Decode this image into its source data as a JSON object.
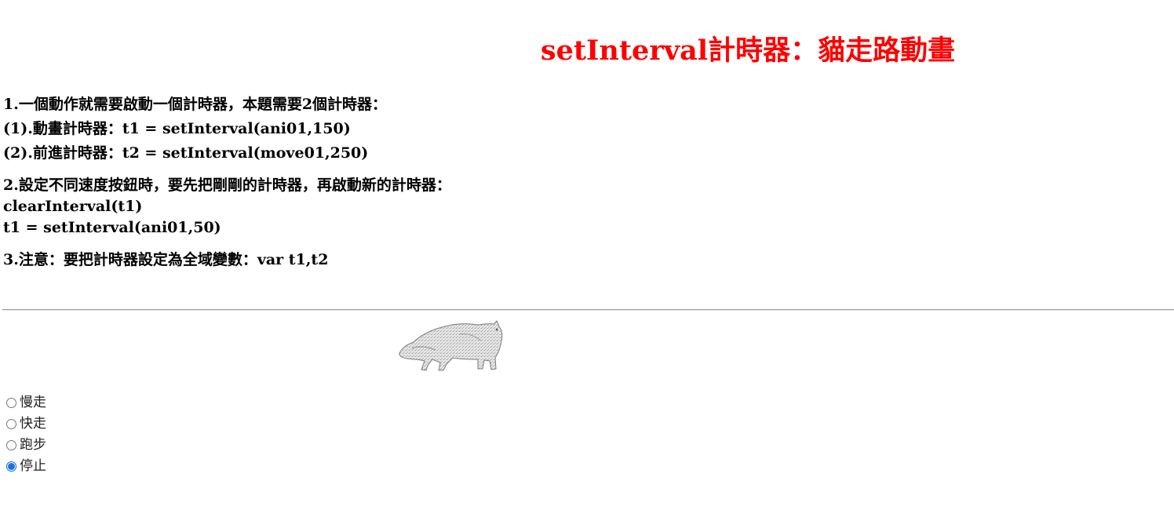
{
  "title": "setInterval計時器：貓走路動畫",
  "notes": {
    "n1": {
      "heading": "1.一個動作就需要啟動一個計時器，本題需要2個計時器：",
      "line1": "(1).動畫計時器：t1 = setInterval(ani01,150)",
      "line2": "(2).前進計時器：t2 = setInterval(move01,250)"
    },
    "n2": {
      "heading": "2.設定不同速度按鈕時，要先把剛剛的計時器，再啟動新的計時器：",
      "line1": "clearInterval(t1)",
      "line2": "t1 = setInterval(ani01,50)"
    },
    "n3": {
      "heading": "3.注意：要把計時器設定為全域變數：var t1,t2"
    }
  },
  "speed_options": [
    {
      "label": "慢走",
      "checked": false
    },
    {
      "label": "快走",
      "checked": false
    },
    {
      "label": "跑步",
      "checked": false
    },
    {
      "label": "停止",
      "checked": true
    }
  ],
  "colors": {
    "title": "#ff0000",
    "radio_checked": "#1a73e8"
  },
  "cat_image": {
    "icon": "walking-cat-image"
  }
}
